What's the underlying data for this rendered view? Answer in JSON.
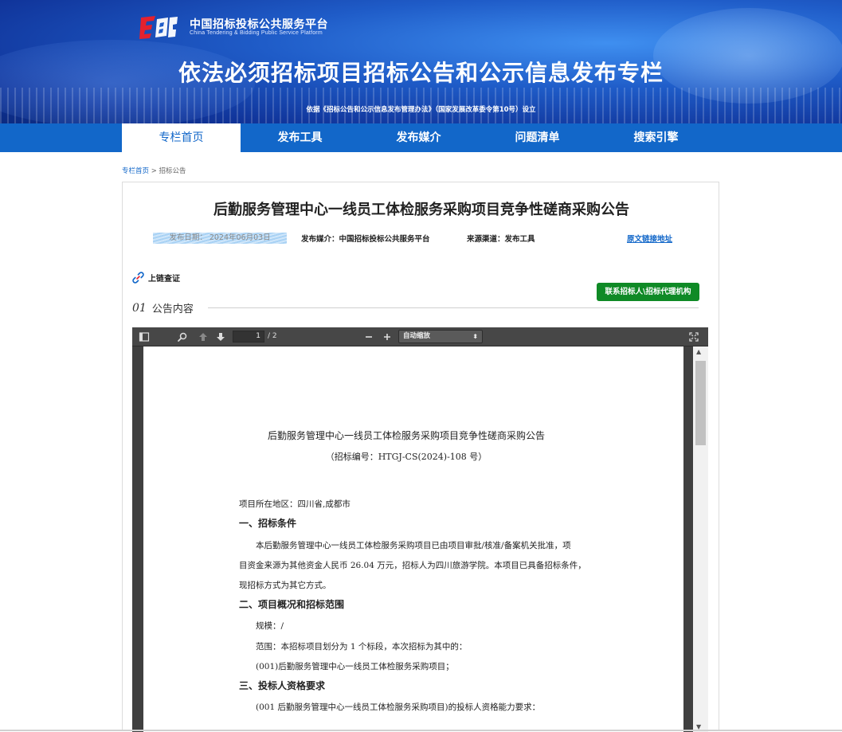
{
  "header": {
    "logo_cn": "中国招标投标公共服务平台",
    "logo_en": "China Tendering & Bidding Public Service Platform",
    "title": "依法必须招标项目招标公告和公示信息发布专栏",
    "subtitle": "依据《招标公告和公示信息发布管理办法》（国家发展改革委令第10号）设立"
  },
  "nav": {
    "items": [
      {
        "label": "专栏首页"
      },
      {
        "label": "发布工具"
      },
      {
        "label": "发布媒介"
      },
      {
        "label": "问题清单"
      },
      {
        "label": "搜索引擎"
      }
    ]
  },
  "breadcrumb": {
    "home": "专栏首页",
    "separator": " > ",
    "current": "招标公告"
  },
  "notice": {
    "title": "后勤服务管理中心一线员工体检服务采购项目竞争性磋商采购公告",
    "publish_date": "发布日期： 2024年06月03日",
    "media": "发布媒介：中国招标投标公共服务平台",
    "channel": "来源渠道：发布工具",
    "source_link": "原文链接地址",
    "chain_label": "上链查证",
    "contact_button": "联系招标人\\招标代理机构",
    "section_num": "01",
    "section_label": "公告内容"
  },
  "viewer": {
    "page_current": "1",
    "page_total": "/ 2",
    "zoom": "自动缩放"
  },
  "doc": {
    "title": "后勤服务管理中心一线员工体检服务采购项目竞争性磋商采购公告",
    "number": "（招标编号：HTGJ-CS(2024)-108 号）",
    "region": "项目所在地区：四川省,成都市",
    "h1": "一、招标条件",
    "p1a": "本后勤服务管理中心一线员工体检服务采购项目已由项目审批/核准/备案机关批准，项",
    "p1b": "目资金来源为其他资金人民币 26.04 万元，招标人为四川旅游学院。本项目已具备招标条件，",
    "p1c": "现招标方式为其它方式。",
    "h2": "二、项目概况和招标范围",
    "scale": "规模：/",
    "scope": "范围：本招标项目划分为 1 个标段，本次招标为其中的：",
    "lot": "(001)后勤服务管理中心一线员工体检服务采购项目；",
    "h3": "三、投标人资格要求",
    "qual": "(001 后勤服务管理中心一线员工体检服务采购项目)的投标人资格能力要求："
  },
  "colors": {
    "nav_blue": "#1267c9",
    "contact_green": "#0f8a26",
    "logo_red": "#e4212e"
  }
}
